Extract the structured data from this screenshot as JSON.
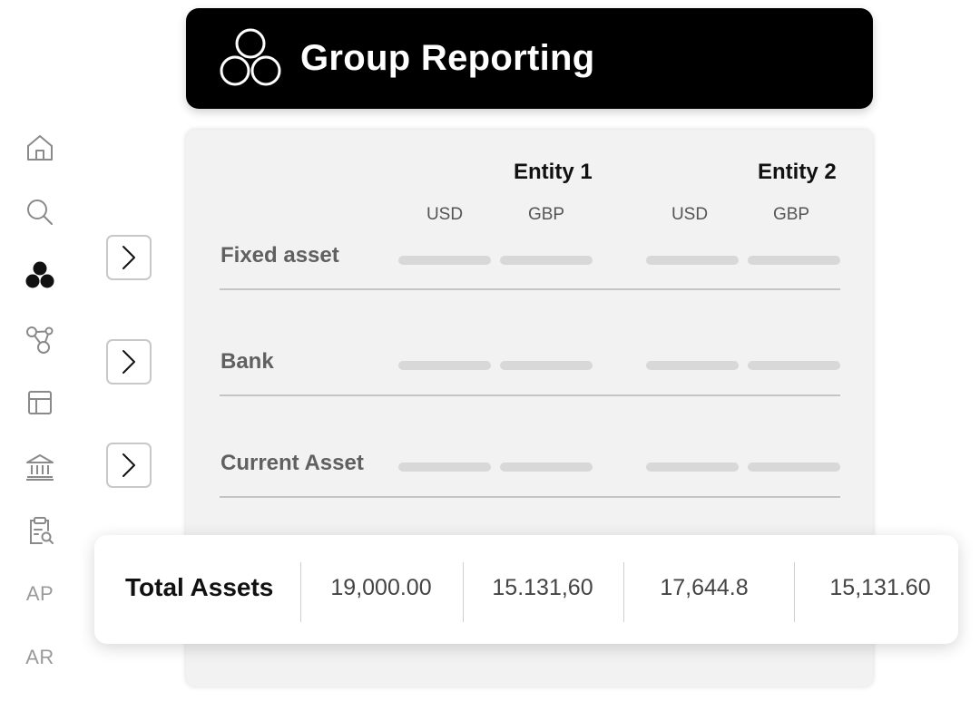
{
  "sidebar": {
    "items": [
      {
        "icon": "home-icon"
      },
      {
        "icon": "search-icon"
      },
      {
        "icon": "group-icon",
        "active": true
      },
      {
        "icon": "network-icon"
      },
      {
        "icon": "table-icon"
      },
      {
        "icon": "bank-icon"
      },
      {
        "icon": "clipboard-search-icon"
      },
      {
        "label": "AP"
      },
      {
        "label": "AR"
      }
    ]
  },
  "header": {
    "title": "Group Reporting",
    "logo_icon": "three-circles-icon"
  },
  "table": {
    "entities": [
      {
        "name": "Entity 1",
        "currencies": [
          "USD",
          "GBP"
        ]
      },
      {
        "name": "Entity 2",
        "currencies": [
          "USD",
          "GBP"
        ]
      }
    ],
    "rows": [
      {
        "label": "Fixed asset"
      },
      {
        "label": "Bank"
      },
      {
        "label": "Current Asset"
      }
    ]
  },
  "totals": {
    "label": "Total Assets",
    "values": [
      "19,000.00",
      "15.131,60",
      "17,644.8",
      "15,131.60"
    ]
  },
  "colors": {
    "header_bg": "#000000",
    "card_bg": "#f2f2f2",
    "active_icon": "#111111",
    "muted_icon": "#8a8a8a"
  }
}
